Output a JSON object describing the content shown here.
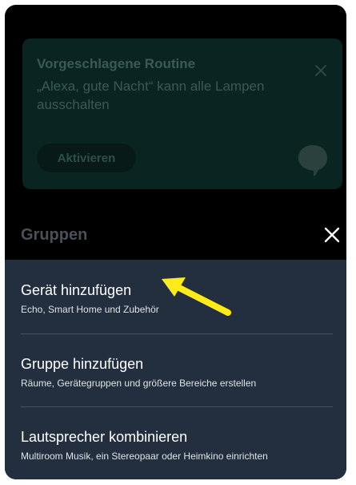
{
  "routine_card": {
    "title": "Vorgeschlagene Routine",
    "text": "„Alexa, gute Nacht“ kann alle Lampen ausschalten",
    "activate_label": "Aktivieren",
    "close_icon": "close-icon",
    "bubble_icon": "speech-bubble-icon"
  },
  "sheet": {
    "title": "Gruppen",
    "close_icon": "close-icon",
    "items": [
      {
        "title": "Gerät hinzufügen",
        "subtitle": "Echo, Smart Home und Zubehör"
      },
      {
        "title": "Gruppe hinzufügen",
        "subtitle": "Räume, Gerätegruppen und größere Bereiche erstellen"
      },
      {
        "title": "Lautsprecher kombinieren",
        "subtitle": "Multiroom Musik, ein Stereopaar oder Heimkino einrichten"
      }
    ]
  },
  "annotation": {
    "arrow_icon": "yellow-arrow-icon",
    "color": "#ffeb1a"
  },
  "colors": {
    "sheet_background": "#232f3e",
    "routine_card_background": "#0a2421"
  }
}
